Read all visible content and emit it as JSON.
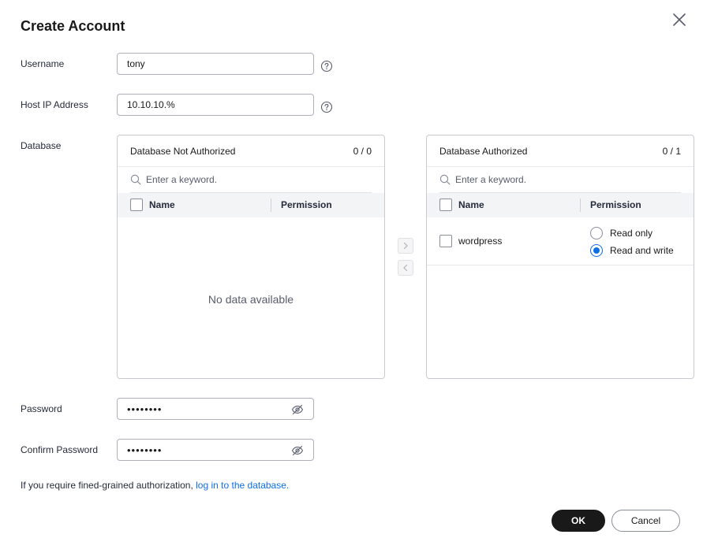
{
  "dialog": {
    "title": "Create Account"
  },
  "form": {
    "username": {
      "label": "Username",
      "value": "tony"
    },
    "host_ip": {
      "label": "Host IP Address",
      "value": "10.10.10.%"
    },
    "database": {
      "label": "Database"
    },
    "password": {
      "label": "Password",
      "value": "••••••••"
    },
    "confirm_password": {
      "label": "Confirm Password",
      "value": "••••••••"
    }
  },
  "transfer": {
    "left": {
      "title": "Database Not Authorized",
      "count": "0 / 0",
      "search_placeholder": "Enter a keyword.",
      "col_name": "Name",
      "col_permission": "Permission",
      "empty_text": "No data available"
    },
    "right": {
      "title": "Database Authorized",
      "count": "0 / 1",
      "search_placeholder": "Enter a keyword.",
      "col_name": "Name",
      "col_permission": "Permission",
      "rows": [
        {
          "name": "wordpress",
          "options": [
            "Read only",
            "Read and write"
          ],
          "selected": "Read and write"
        }
      ]
    }
  },
  "hint": {
    "text": "If you require fined-grained authorization, ",
    "link": "log in to the database."
  },
  "actions": {
    "ok": "OK",
    "cancel": "Cancel"
  },
  "colors": {
    "primary": "#191919",
    "accent": "#0d6fe8",
    "border": "#adb0b8"
  }
}
